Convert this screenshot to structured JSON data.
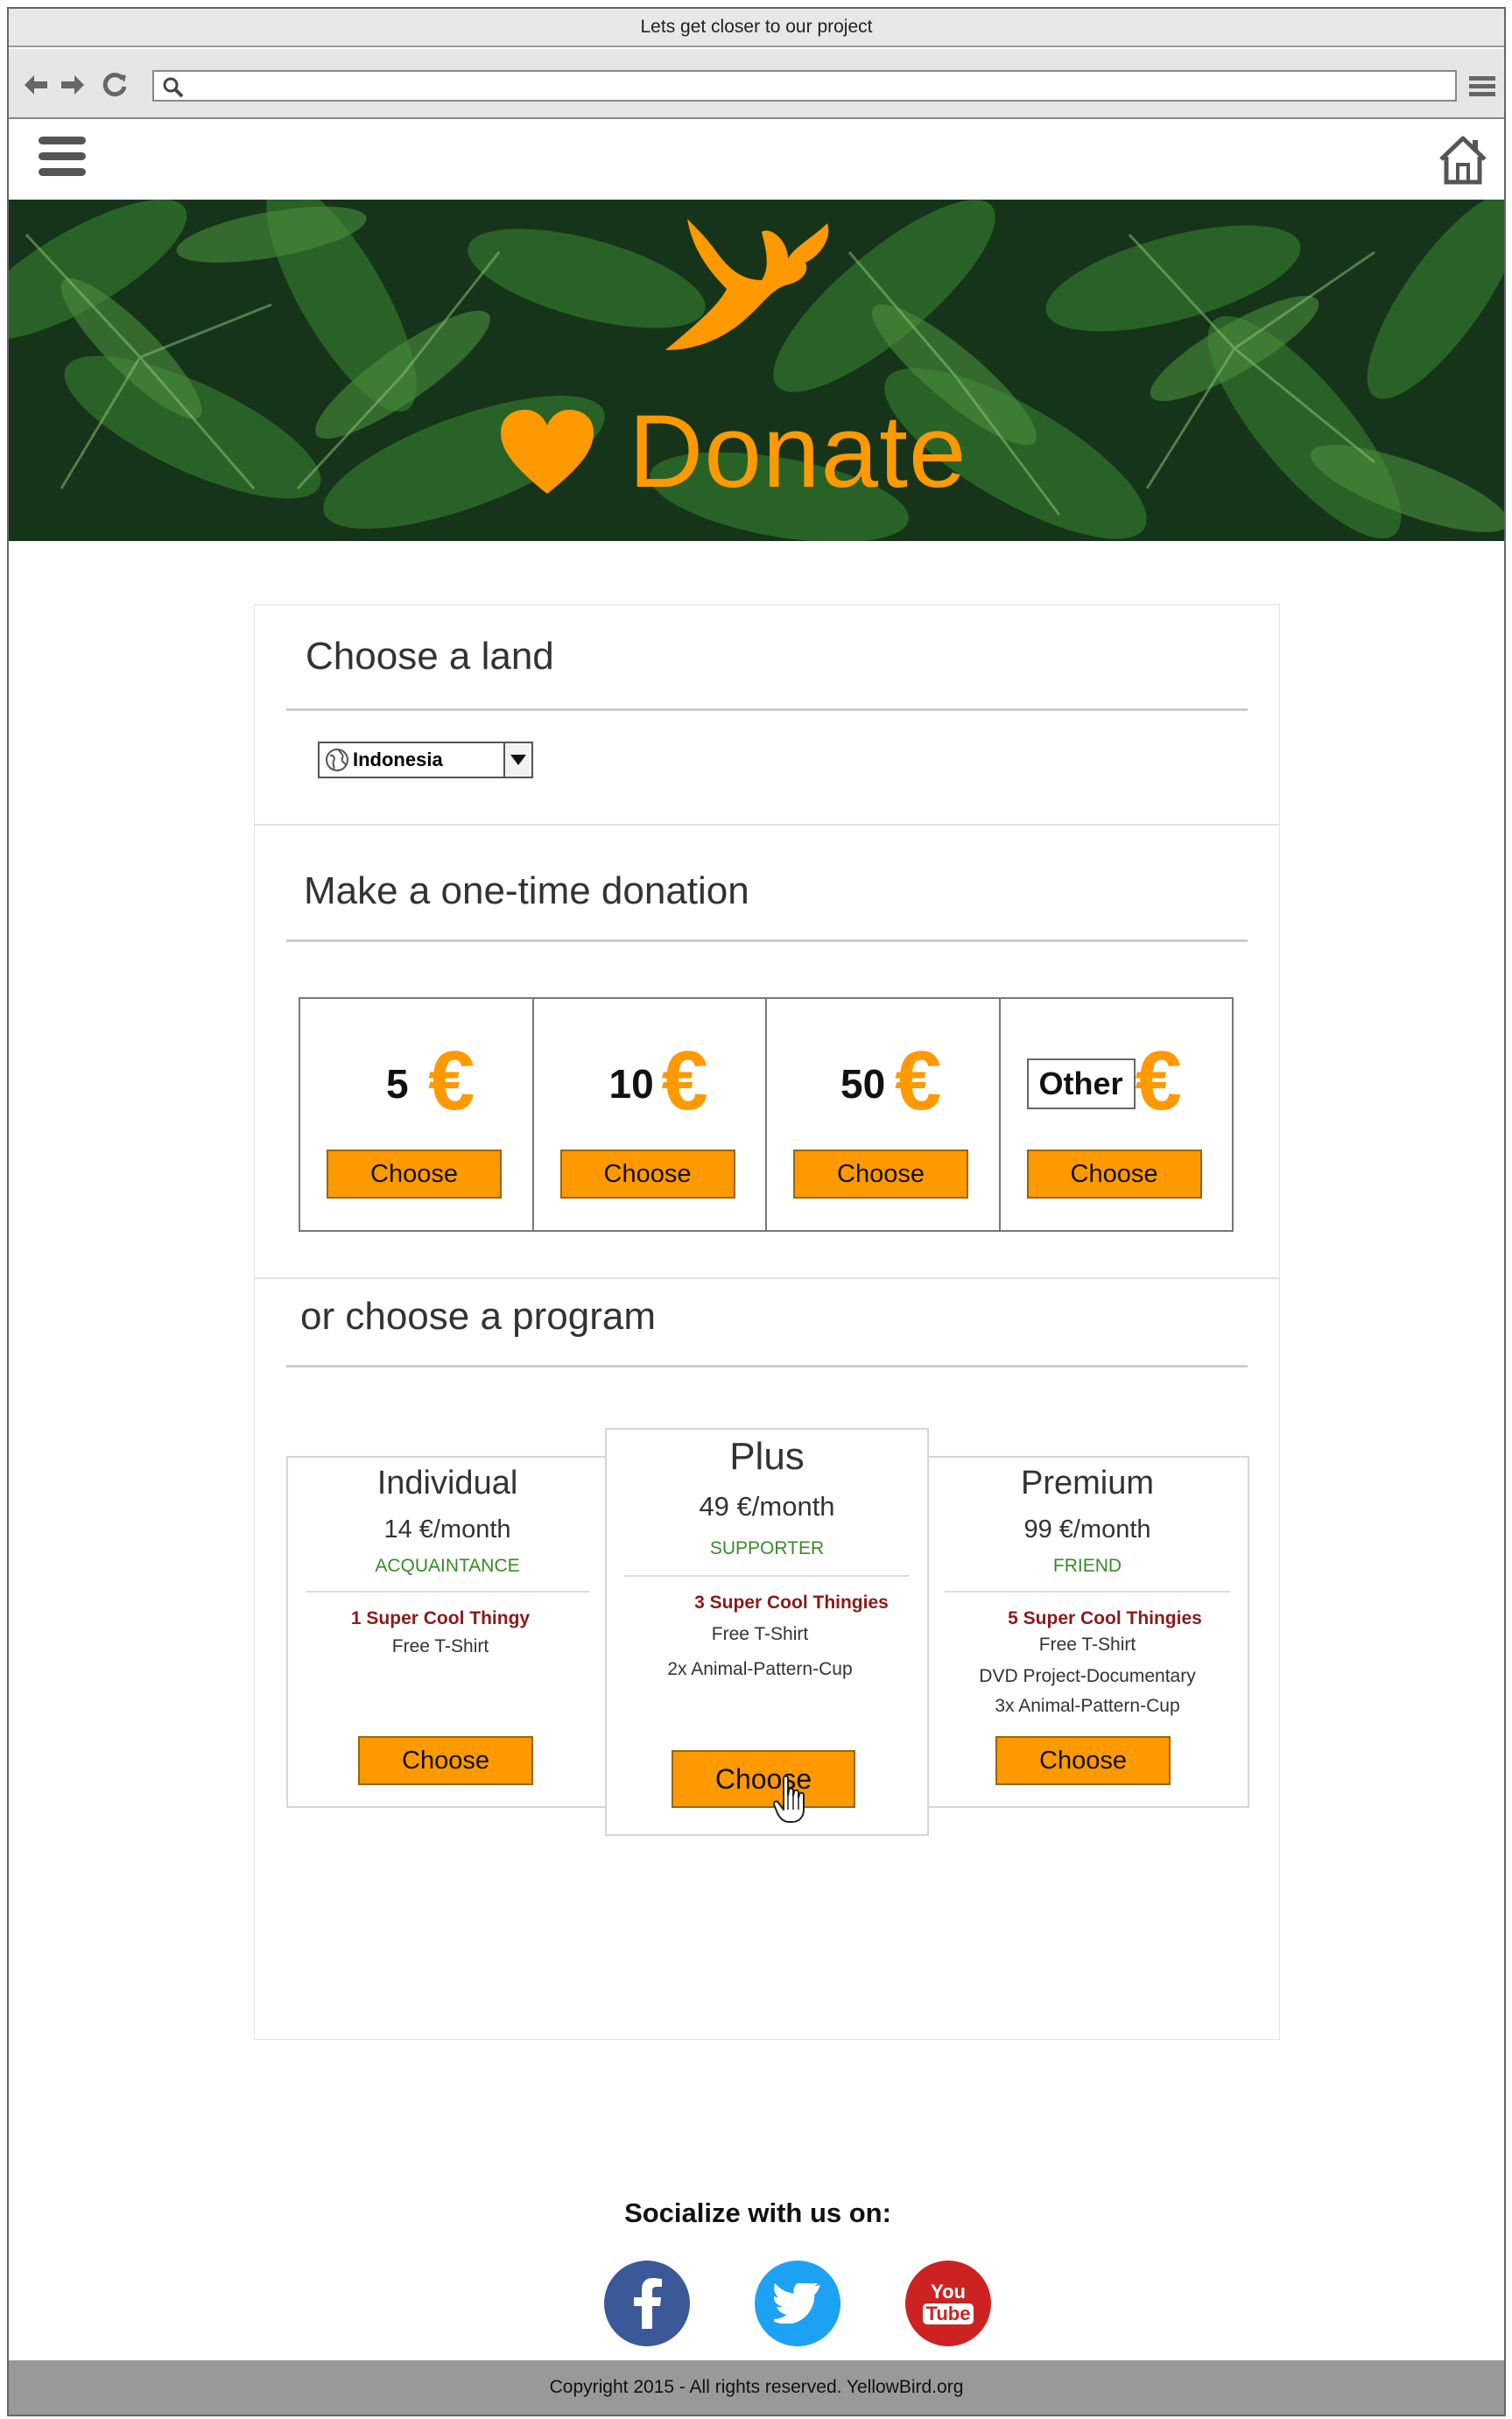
{
  "window": {
    "title": "Lets get closer to our project"
  },
  "browser": {
    "url": "",
    "search_placeholder": ""
  },
  "hero": {
    "title": "Donate"
  },
  "land": {
    "title": "Choose a land",
    "selected": "Indonesia"
  },
  "donation": {
    "title": "Make a one-time donation",
    "amounts": [
      {
        "value": "5",
        "currency": "€",
        "button": "Choose"
      },
      {
        "value": "10",
        "currency": "€",
        "button": "Choose"
      },
      {
        "value": "50",
        "currency": "€",
        "button": "Choose"
      },
      {
        "value": "Other",
        "currency": "€",
        "button": "Choose"
      }
    ]
  },
  "programs": {
    "title": "or choose a program",
    "plans": [
      {
        "name": "Individual",
        "price": "14 €/month",
        "tier": "ACQUAINTANCE",
        "feature_head": "1 Super Cool Thingy",
        "features": [
          "Free T-Shirt"
        ],
        "button": "Choose"
      },
      {
        "name": "Plus",
        "price": "49 €/month",
        "tier": "SUPPORTER",
        "feature_head": "3 Super Cool Thingies",
        "features": [
          "Free T-Shirt",
          "2x Animal-Pattern-Cup"
        ],
        "button": "Choose"
      },
      {
        "name": "Premium",
        "price": "99 €/month",
        "tier": "FRIEND",
        "feature_head": "5 Super Cool Thingies",
        "features": [
          "Free T-Shirt",
          "DVD Project-Documentary",
          "3x Animal-Pattern-Cup"
        ],
        "button": "Choose"
      }
    ]
  },
  "social": {
    "title": "Socialize with us on:",
    "networks": [
      {
        "name": "facebook-icon",
        "color": "#3b5998"
      },
      {
        "name": "twitter-icon",
        "color": "#1da1f2"
      },
      {
        "name": "youtube-icon",
        "color": "#cc2222",
        "label_top": "You",
        "label_bottom": "Tube"
      }
    ]
  },
  "footer": {
    "text": "Copyright 2015  - All rights reserved. YellowBird.org"
  },
  "colors": {
    "accent": "#ff9900",
    "tier_green": "#3a8a2a",
    "feature_red": "#8b1a1a",
    "footer_bg": "#999999"
  }
}
